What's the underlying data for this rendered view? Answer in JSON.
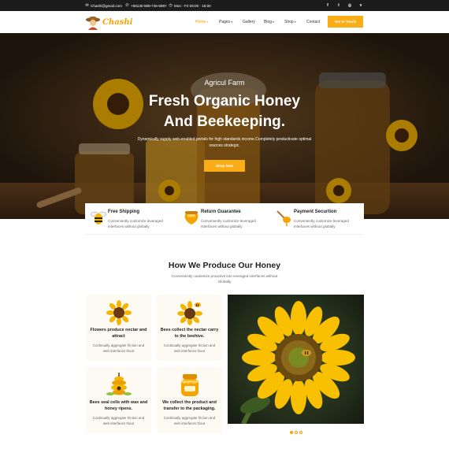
{
  "topbar": {
    "email": "Chashi@gmail.com",
    "phone": "+88130-589-745-6987",
    "hours": "Mon - Fri 09:00 - 18:00",
    "email_icon": "mail-icon",
    "phone_icon": "phone-icon",
    "clock_icon": "clock-icon",
    "socials": [
      {
        "icon": "facebook-icon",
        "glyph": "f"
      },
      {
        "icon": "twitter-icon",
        "glyph": "t"
      },
      {
        "icon": "instagram-icon",
        "glyph": "◎"
      },
      {
        "icon": "vimeo-icon",
        "glyph": "v"
      }
    ]
  },
  "header": {
    "logo_text": "Chashi",
    "nav": [
      {
        "label": "Home",
        "active": true,
        "dropdown": true
      },
      {
        "label": "Pages",
        "active": false,
        "dropdown": true
      },
      {
        "label": "Gallery",
        "active": false,
        "dropdown": false
      },
      {
        "label": "Blog",
        "active": false,
        "dropdown": true
      },
      {
        "label": "Shop",
        "active": false,
        "dropdown": true
      },
      {
        "label": "Contact",
        "active": false,
        "dropdown": false
      }
    ],
    "cta_label": "Get In Touch"
  },
  "hero": {
    "subtitle": "Agricul Farm",
    "title_line1": "Fresh Organic Honey",
    "title_line2": "And Beekeeping.",
    "description": "Dynamically supply web-enabled portals for high standards income.Completely productivate optimal sources strategic.",
    "button_label": "Shop Now"
  },
  "features": [
    {
      "title": "Free Shipping",
      "description": "Conveniently customize leveraged interfaces without globally",
      "icon": "bee-icon"
    },
    {
      "title": "Return Guarantee",
      "description": "Conveniently customize leveraged interfaces without globally",
      "icon": "honey-pot-icon"
    },
    {
      "title": "Payment Securtion",
      "description": "Conveniently customize leveraged interfaces without globally",
      "icon": "honey-dipper-icon"
    }
  ],
  "process": {
    "title": "How We Produce Our Honey",
    "description": "Conveniently customize proactive into everaged interfaces without Globally",
    "cards": [
      {
        "title": "Flowers produce nectar and attract",
        "description": "Continually aggregate friction and web interfaces thout",
        "icon": "sunflower-icon"
      },
      {
        "title": "Bees collect the nectar carry to the beehive.",
        "description": "Continually aggregate friction and web interfaces thout",
        "icon": "sunflower-bee-icon"
      },
      {
        "title": "Bees seal cells with wax and honey ripens.",
        "description": "Continually aggregate friction and web interfaces thout",
        "icon": "beehive-icon"
      },
      {
        "title": "We collect the product and transfer to the packaging.",
        "description": "Continually aggregate friction and web interfaces thout",
        "icon": "honey-jar-icon"
      }
    ],
    "carousel_dots": [
      true,
      false,
      false
    ]
  },
  "colors": {
    "accent": "#fbad18",
    "dark": "#1c1c1c"
  }
}
